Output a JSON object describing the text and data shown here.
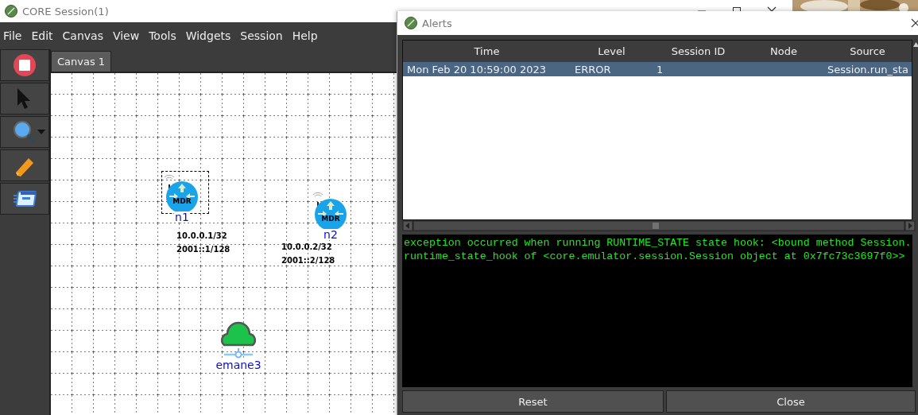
{
  "window": {
    "title": "CORE Session(1)"
  },
  "menu": [
    "File",
    "Edit",
    "Canvas",
    "View",
    "Tools",
    "Widgets",
    "Session",
    "Help"
  ],
  "toolbar": [
    {
      "kind": "stop"
    },
    {
      "kind": "select"
    },
    {
      "kind": "marker",
      "dropdown": true
    },
    {
      "kind": "pencil"
    },
    {
      "kind": "note"
    }
  ],
  "canvas_tabs": [
    {
      "label": "Canvas 1",
      "selected": true
    }
  ],
  "nodes": [
    {
      "kind": "router",
      "badge": "MDR",
      "name": "n1",
      "selected": true,
      "addresses": [
        "10.0.0.1/32",
        "2001::1/128"
      ]
    },
    {
      "kind": "router",
      "badge": "MDR",
      "name": "n2",
      "selected": false,
      "addresses": [
        "10.0.0.2/32",
        "2001::2/128"
      ]
    },
    {
      "kind": "cloud",
      "name": "emane3",
      "selected": false
    }
  ],
  "alerts": {
    "title": "Alerts",
    "columns": [
      "Time",
      "Level",
      "Session ID",
      "Node",
      "Source"
    ],
    "rows": [
      {
        "selected": true,
        "cells": [
          "Mon Feb 20 10:59:00 2023",
          "ERROR",
          "1",
          "",
          "Session.run_sta"
        ]
      }
    ],
    "output": [
      "exception occurred when running RUNTIME_STATE state hook: <bound method Session.",
      "runtime_state_hook of <core.emulator.session.Session object at 0x7fc73c3697f0>>"
    ],
    "buttons": [
      "Reset",
      "Close"
    ]
  }
}
